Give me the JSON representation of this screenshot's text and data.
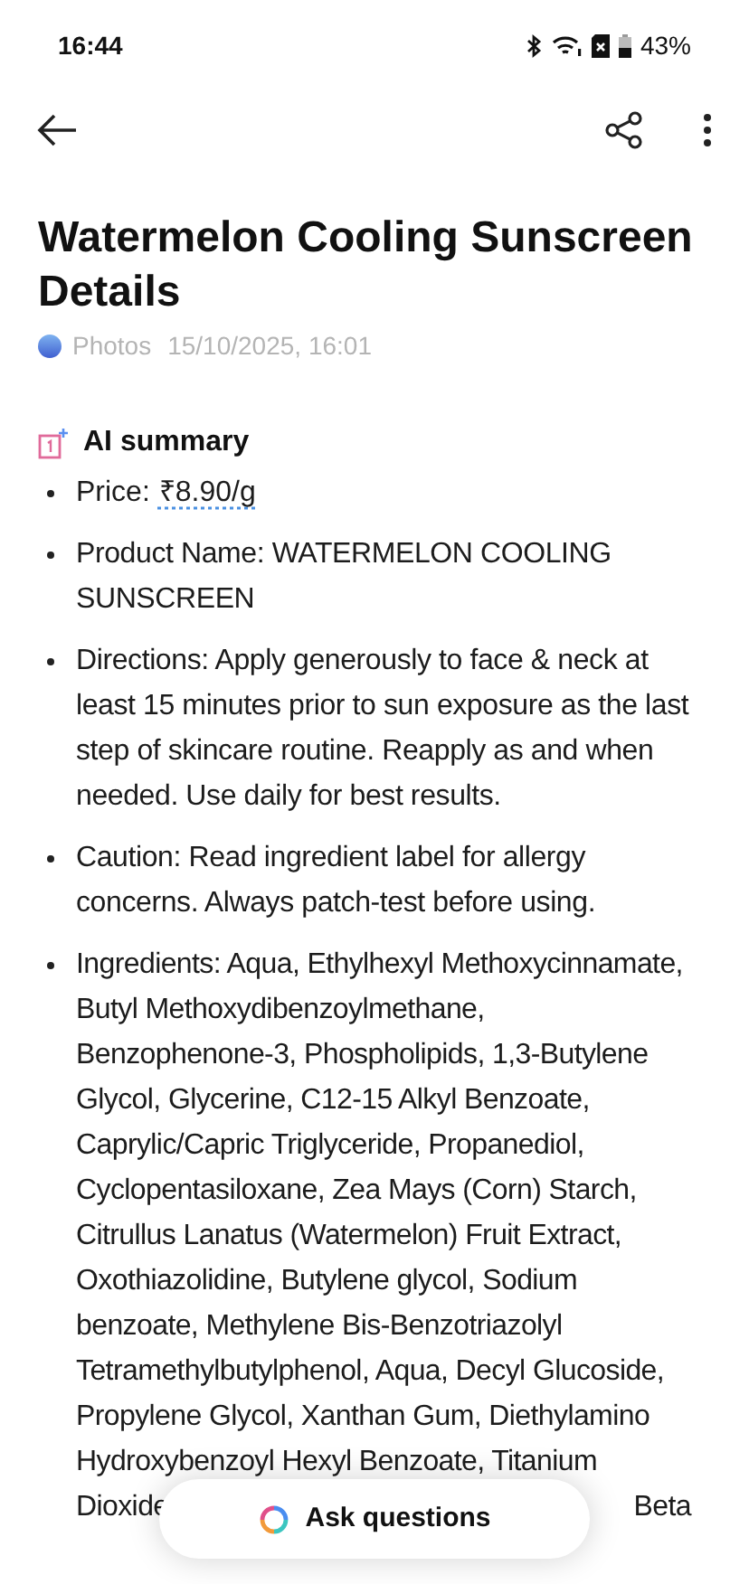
{
  "status_bar": {
    "time": "16:44",
    "battery": "43%"
  },
  "title": "Watermelon Cooling Sunscreen Details",
  "meta": {
    "source": "Photos",
    "date": "15/10/2025, 16:01"
  },
  "summary": {
    "heading": "AI summary",
    "items": [
      {
        "kind": "price",
        "label": "Price:",
        "value": "₹8.90/g"
      },
      {
        "kind": "text",
        "text": "Product Name: WATERMELON COOLING SUNSCREEN"
      },
      {
        "kind": "text",
        "text": "Directions: Apply generously to face & neck at least 15 minutes prior to sun exposure as the last step of skincare routine. Reapply as and when needed. Use daily for best results."
      },
      {
        "kind": "text",
        "text": "Caution: Read ingredient label for allergy concerns. Always patch-test before using."
      },
      {
        "kind": "lines",
        "lines": [
          "Ingredients: Aqua, Ethylhexyl Methoxycinnamate,",
          "Butyl Methoxydibenzoylmethane,",
          "Benzophenone-3, Phospholipids, 1,3-Butylene",
          "Glycol, Glycerine, C12-15 Alkyl Benzoate,",
          "Caprylic/Capric Triglyceride, Propanediol,",
          "Cyclopentasiloxane, Zea Mays (Corn) Starch,",
          "Citrullus Lanatus (Watermelon) Fruit Extract,",
          "Oxothiazolidine, Butylene glycol, Sodium",
          "benzoate, Methylene Bis-Benzotriazolyl",
          "Tetramethylbutylphenol, Aqua, Decyl Glucoside,",
          "Propylene Glycol, Xanthan Gum, Diethylamino",
          "Hydroxybenzoyl Hexyl Benzoate, Titanium"
        ],
        "covered_line": {
          "left": "Dioxide",
          "right": "Beta"
        }
      }
    ]
  },
  "ask_button": {
    "label": "Ask questions"
  }
}
